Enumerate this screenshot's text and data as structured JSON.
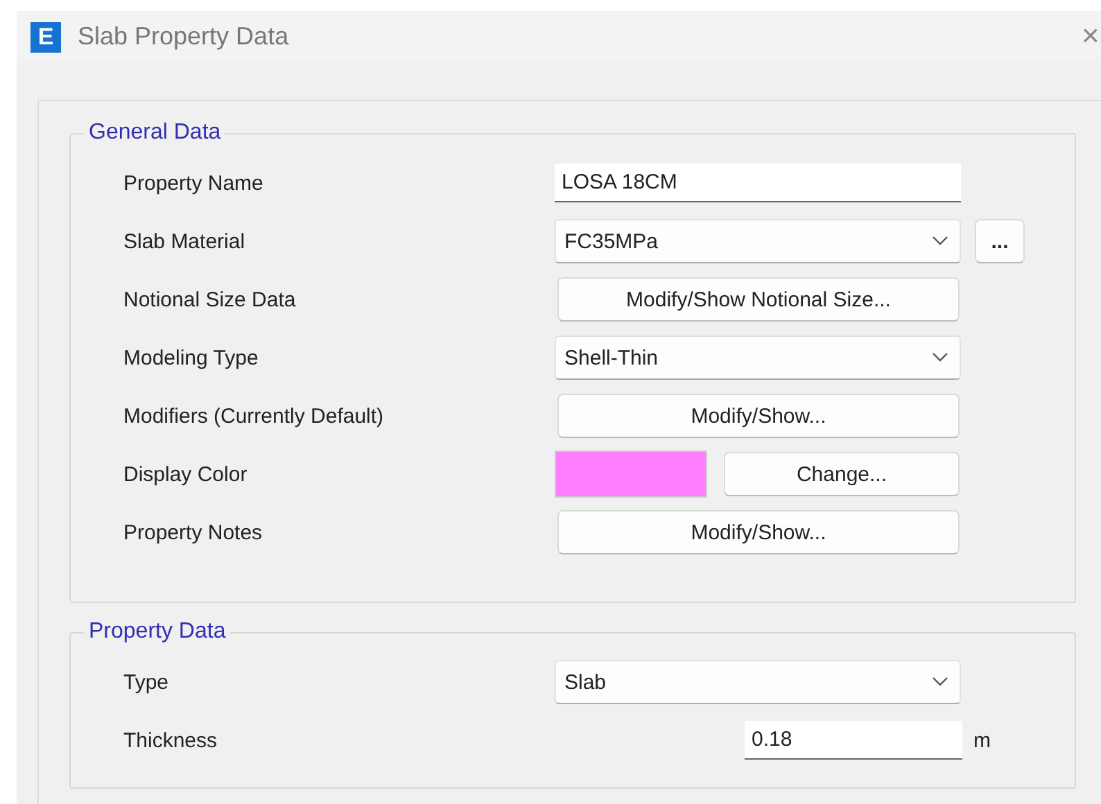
{
  "window": {
    "title": "Slab Property Data",
    "icon_letter": "E",
    "close": "×"
  },
  "general_data": {
    "legend": "General Data",
    "rows": [
      {
        "label": "Property Name",
        "kind": "text",
        "value": "LOSA 18CM"
      },
      {
        "label": "Slab Material",
        "kind": "combo",
        "value": "FC35MPa",
        "extra_button": "..."
      },
      {
        "label": "Notional Size Data",
        "kind": "button",
        "button": "Modify/Show Notional Size..."
      },
      {
        "label": "Modeling Type",
        "kind": "combo",
        "value": "Shell-Thin"
      },
      {
        "label": "Modifiers (Currently Default)",
        "kind": "button",
        "button": "Modify/Show..."
      },
      {
        "label": "Display Color",
        "kind": "color",
        "color": "#ff80ff",
        "button": "Change..."
      },
      {
        "label": "Property Notes",
        "kind": "button",
        "button": "Modify/Show..."
      }
    ]
  },
  "property_data": {
    "legend": "Property Data",
    "rows": [
      {
        "label": "Type",
        "kind": "combo",
        "value": "Slab"
      },
      {
        "label": "Thickness",
        "kind": "number",
        "value": "0.18",
        "unit": "m"
      }
    ]
  }
}
